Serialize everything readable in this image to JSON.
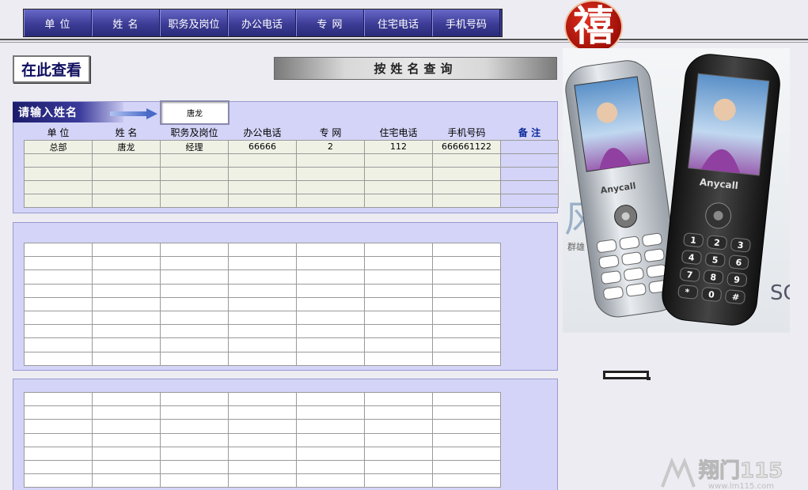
{
  "nav": {
    "unit": "单  位",
    "name": "姓  名",
    "position": "职务及岗位",
    "office_phone": "办公电话",
    "private_net": "专  网",
    "home_phone": "住宅电话",
    "mobile": "手机号码"
  },
  "logo_char": "禧",
  "view_here": "在此查看",
  "query_title": "按姓名查询",
  "search": {
    "label": "请输入姓名",
    "value": "唐龙"
  },
  "result_table": {
    "headers": [
      "单  位",
      "姓  名",
      "职务及岗位",
      "办公电话",
      "专  网",
      "住宅电话",
      "手机号码",
      "备  注"
    ],
    "rows": [
      [
        "总部",
        "唐龙",
        "经理",
        "66666",
        "2",
        "112",
        "666661122",
        ""
      ]
    ]
  },
  "ad": {
    "brand_left": "Anycall",
    "brand_right": "Anycall",
    "side_text_1": "风",
    "side_text_2": "群雄",
    "side_text_3": "SC",
    "keys": [
      "1",
      "2",
      "3",
      "4",
      "5",
      "6",
      "7",
      "8",
      "9",
      "*",
      "0",
      "#"
    ]
  },
  "watermark": {
    "brand": "翔门115",
    "url": "www.lm115.com"
  },
  "colors": {
    "nav_blue": "#3c3c96",
    "panel": "#d4d4f8",
    "logo_red": "#a01008",
    "note_blue": "#0a2a9a"
  }
}
